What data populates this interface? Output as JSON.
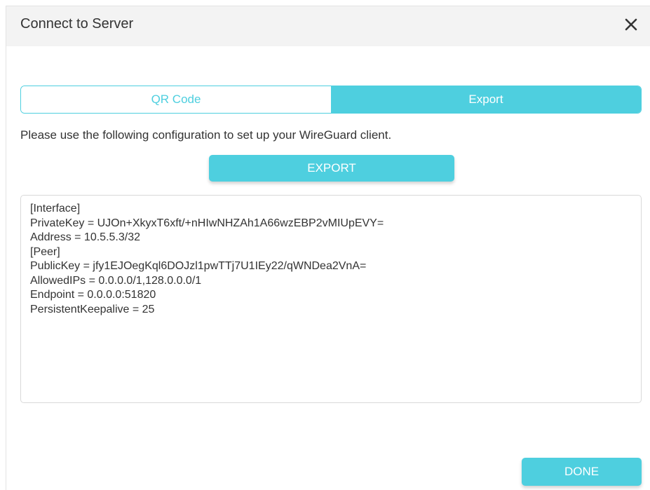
{
  "dialog": {
    "title": "Connect to Server",
    "close_icon": "close-icon"
  },
  "tabs": [
    {
      "label": "QR Code",
      "active": false
    },
    {
      "label": "Export",
      "active": true
    }
  ],
  "instruction": "Please use the following configuration to set up your WireGuard client.",
  "export_button": "EXPORT",
  "config_lines": [
    "[Interface]",
    "PrivateKey = UJOn+XkyxT6xft/+nHIwNHZAh1A66wzEBP2vMIUpEVY=",
    "Address = 10.5.5.3/32",
    "[Peer]",
    "PublicKey = jfy1EJOegKql6DOJzl1pwTTj7U1IEy22/qWNDea2VnA=",
    "AllowedIPs = 0.0.0.0/1,128.0.0.0/1",
    "Endpoint = 0.0.0.0:51820",
    "PersistentKeepalive = 25"
  ],
  "done_button": "DONE",
  "colors": {
    "accent": "#4ecfdf",
    "header_bg": "#f3f3f3",
    "text": "#333333"
  }
}
